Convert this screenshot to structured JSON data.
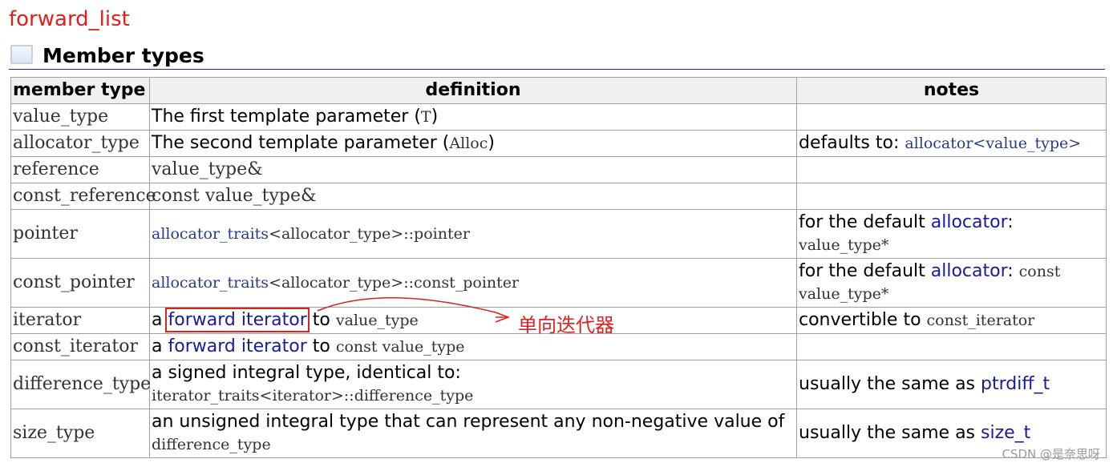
{
  "page_title": "forward_list",
  "section": {
    "icon": "section-icon",
    "title": "Member types"
  },
  "headers": {
    "member_type": "member type",
    "definition": "definition",
    "notes": "notes"
  },
  "rows": [
    {
      "name": "value_type",
      "def_pre": "The first template parameter (",
      "def_code": "T",
      "def_post": ")",
      "notes": ""
    },
    {
      "name": "allocator_type",
      "def_pre": "The second template parameter (",
      "def_code": "Alloc",
      "def_post": ")",
      "notes_pre": "defaults to: ",
      "notes_code": "allocator<value_type>"
    },
    {
      "name": "reference",
      "def_code": "value_type&"
    },
    {
      "name": "const_reference",
      "def_code": "const value_type&"
    },
    {
      "name": "pointer",
      "def_link": "allocator_traits",
      "def_code": "<allocator_type>::pointer",
      "notes_pre": "for the default ",
      "notes_link": "allocator",
      "notes_post": ":",
      "notes_code": "value_type*"
    },
    {
      "name": "const_pointer",
      "def_link": "allocator_traits",
      "def_code": "<allocator_type>::const_pointer",
      "notes_pre": "for the default ",
      "notes_link": "allocator",
      "notes_post": ": ",
      "notes_code1": "const",
      "notes_code2": "value_type*"
    },
    {
      "name": "iterator",
      "def_pre": "a ",
      "def_link": "forward iterator",
      "def_mid": " to ",
      "def_code": "value_type",
      "notes_pre": "convertible to ",
      "notes_code": "const_iterator"
    },
    {
      "name": "const_iterator",
      "def_pre": "a ",
      "def_link": "forward iterator",
      "def_mid": " to ",
      "def_code": "const value_type"
    },
    {
      "name": "difference_type",
      "def_pre": "a signed integral type, identical to:",
      "def_code": "iterator_traits<iterator>::difference_type",
      "notes_pre": "usually the same as ",
      "notes_link": "ptrdiff_t"
    },
    {
      "name": "size_type",
      "def_pre": "an unsigned integral type that can represent any non-negative value of ",
      "def_code": "difference_type",
      "notes_pre": "usually the same as ",
      "notes_link": "size_t"
    }
  ],
  "annotation": {
    "text": "单向迭代器",
    "color": "#e02020"
  },
  "watermark": "CSDN @是奈思呀",
  "colors": {
    "title": "#e02020",
    "link": "#1a1a9e",
    "header_bg": "#eef0f2"
  }
}
